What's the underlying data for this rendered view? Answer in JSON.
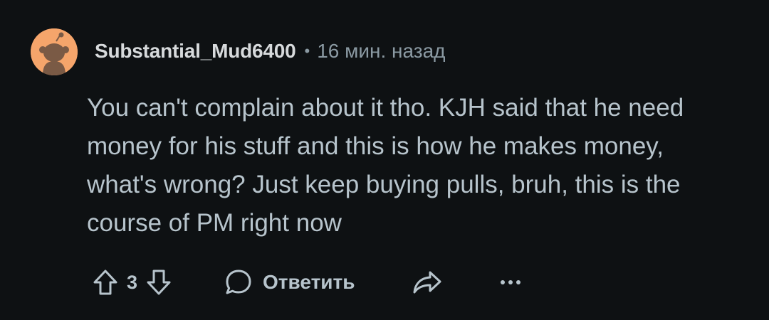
{
  "comment": {
    "author": "Substantial_Mud6400",
    "separator": "•",
    "time_ago": "16 мин. назад",
    "body": "You can't complain about it tho. KJH said that he need money for his stuff and this is how he makes money, what's wrong? Just keep buying pulls, bruh, this is the course of PM right now",
    "score": "3",
    "reply_label": "Ответить",
    "avatar_color": "#f5a56b"
  },
  "icons": {
    "upvote": "upvote-icon",
    "downvote": "downvote-icon",
    "reply": "comment-bubble-icon",
    "share": "share-arrow-icon",
    "more": "more-options-icon"
  }
}
